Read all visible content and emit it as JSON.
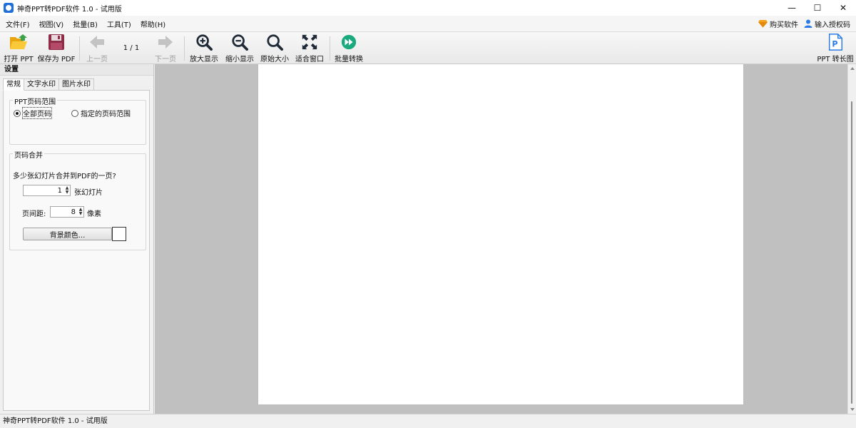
{
  "window": {
    "title": "神奇PPT转PDF软件 1.0 - 试用版",
    "controls": {
      "minimize": "—",
      "maximize": "☐",
      "close": "✕"
    }
  },
  "menu": {
    "items": [
      "文件(F)",
      "视图(V)",
      "批量(B)",
      "工具(T)",
      "帮助(H)"
    ],
    "buy": "购买软件",
    "license": "输入授权码"
  },
  "toolbar": {
    "open_ppt": "打开 PPT",
    "save_pdf": "保存为 PDF",
    "prev_page": "上一页",
    "page_indicator": "1 / 1",
    "next_page": "下一页",
    "zoom_in": "放大显示",
    "zoom_out": "缩小显示",
    "original_size": "原始大小",
    "fit_window": "适合窗口",
    "batch_convert": "批量转换",
    "ppt_to_long_image": "PPT 转长图"
  },
  "settings": {
    "title": "设置",
    "tabs": [
      "常规",
      "文字水印",
      "图片水印"
    ],
    "page_range": {
      "group_title": "PPT页码范围",
      "all_pages": "全部页码",
      "specified_range": "指定的页码范围"
    },
    "merge": {
      "group_title": "页码合并",
      "question": "多少张幻灯片合并到PDF的一页?",
      "slides_value": "1",
      "slides_unit": "张幻灯片",
      "spacing_label": "页间距:",
      "spacing_value": "8",
      "spacing_unit": "像素",
      "bg_color_button": "背景颜色..."
    }
  },
  "status": {
    "text": "神奇PPT转PDF软件 1.0 - 试用版"
  },
  "colors": {
    "preview_bg": "#c0c0c0",
    "page_bg": "#ffffff",
    "batch_icon": "#1aaa7e",
    "folder_icon": "#f2b51c",
    "save_icon": "#8e2d48",
    "long_image_icon": "#2b7be5"
  }
}
